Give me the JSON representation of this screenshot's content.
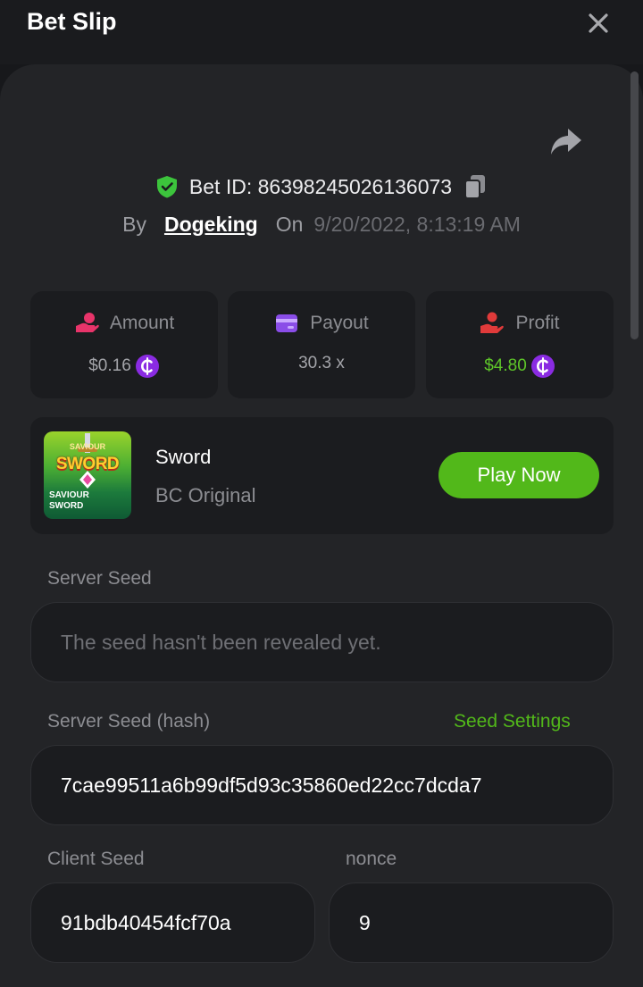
{
  "header": {
    "title": "Bet Slip"
  },
  "bet": {
    "id_text": "Bet ID: 86398245026136073",
    "by_label": "By",
    "username": "Dogeking",
    "on_label": "On",
    "date": "9/20/2022, 8:13:19 AM"
  },
  "stats": {
    "amount": {
      "label": "Amount",
      "value": "$0.16"
    },
    "payout": {
      "label": "Payout",
      "value": "30.3 x"
    },
    "profit": {
      "label": "Profit",
      "value": "$4.80"
    }
  },
  "game": {
    "name": "Sword",
    "tag": "BC Original",
    "thumb_title": "SWORD",
    "thumb_small": "SAVIOUR",
    "thumb_sub_1": "SAVIOUR",
    "thumb_sub_2": "SWORD",
    "play_label": "Play Now"
  },
  "server_seed": {
    "label": "Server Seed",
    "placeholder": "The seed hasn't been revealed yet."
  },
  "server_seed_hash": {
    "label": "Server Seed (hash)",
    "settings_link": "Seed Settings",
    "value": "7cae99511a6b99df5d93c35860ed22cc7dcda7"
  },
  "client_seed": {
    "label": "Client Seed",
    "value": "91bdb40454fcf70a"
  },
  "nonce": {
    "label": "nonce",
    "value": "9"
  },
  "colors": {
    "accent_green": "#52b81a",
    "profit_green": "#5ec629",
    "coin_purple": "#8a2be2",
    "amount_pink": "#e8346a",
    "payout_purple": "#8a4de8",
    "profit_red": "#e03a3a"
  },
  "icons": {
    "close": "close-icon",
    "share": "share-icon",
    "shield": "shield-check-icon",
    "copy": "copy-icon",
    "amount": "coins-hand-icon",
    "payout": "wallet-card-icon",
    "profit": "profit-hand-icon",
    "coin": "bc-coin-icon"
  }
}
